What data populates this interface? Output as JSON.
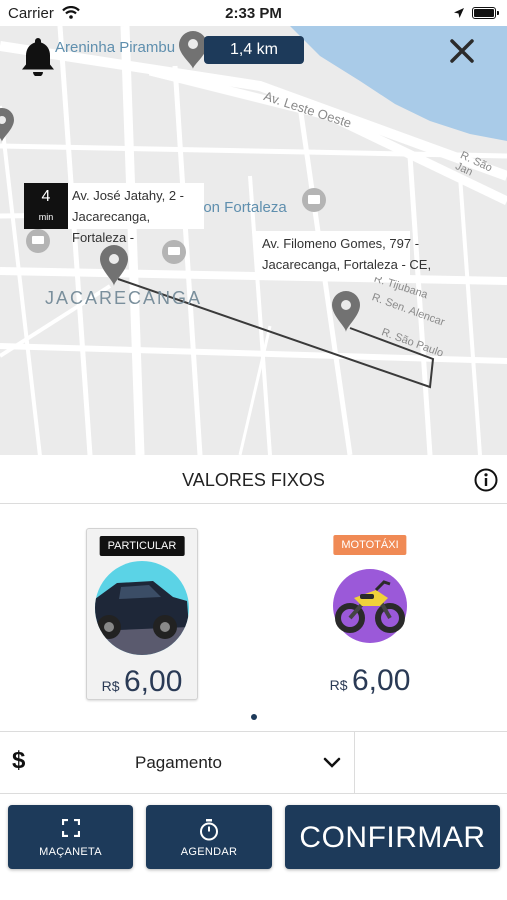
{
  "status_bar": {
    "carrier": "Carrier",
    "time": "2:33 PM"
  },
  "map": {
    "distance": "1,4 km",
    "places": {
      "areninha": "Areninha Pirambu",
      "fortaleza": "ion Fortaleza",
      "district": "JACARECANGA"
    },
    "streets": {
      "leste_oeste": "Av. Leste Oeste",
      "sao_jan": "R. São Jan",
      "tijubana": "R. Tijubana",
      "sen_alencar": "R. Sen. Alencar",
      "sao_paulo": "R. São Paulo"
    },
    "origin": {
      "eta_value": "4",
      "eta_unit": "min",
      "line1": "Av. José Jatahy, 2 -",
      "line2": "Jacarecanga, Fortaleza -"
    },
    "destination": {
      "line1": "Av. Filomeno Gomes, 797 -",
      "line2": "Jacarecanga, Fortaleza - CE,"
    }
  },
  "fare": {
    "title": "VALORES FIXOS",
    "options": [
      {
        "badge": "PARTICULAR",
        "currency": "R$",
        "price": "6,00",
        "selected": true
      },
      {
        "badge": "MOTOTÁXI",
        "currency": "R$",
        "price": "6,00",
        "selected": false
      }
    ]
  },
  "payment": {
    "label": "Pagamento"
  },
  "actions": {
    "handle": "MAÇANETA",
    "schedule": "AGENDAR",
    "confirm": "CONFIRMAR"
  },
  "colors": {
    "primary": "#1d3a5a",
    "moto_badge": "#f08a55",
    "water": "#a9cbe8",
    "map_bg": "#ebebeb"
  }
}
